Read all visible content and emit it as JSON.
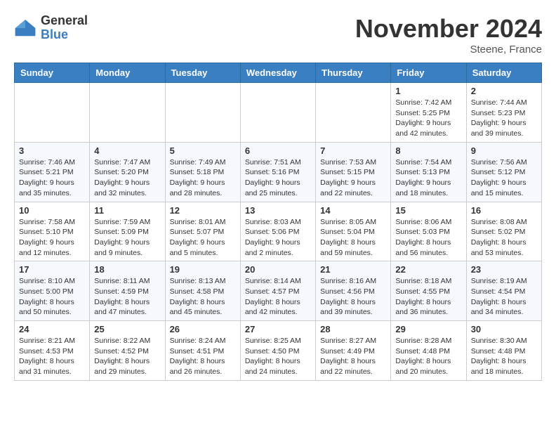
{
  "logo": {
    "general": "General",
    "blue": "Blue"
  },
  "title": "November 2024",
  "location": "Steene, France",
  "days_header": [
    "Sunday",
    "Monday",
    "Tuesday",
    "Wednesday",
    "Thursday",
    "Friday",
    "Saturday"
  ],
  "weeks": [
    [
      {
        "day": "",
        "info": ""
      },
      {
        "day": "",
        "info": ""
      },
      {
        "day": "",
        "info": ""
      },
      {
        "day": "",
        "info": ""
      },
      {
        "day": "",
        "info": ""
      },
      {
        "day": "1",
        "info": "Sunrise: 7:42 AM\nSunset: 5:25 PM\nDaylight: 9 hours and 42 minutes."
      },
      {
        "day": "2",
        "info": "Sunrise: 7:44 AM\nSunset: 5:23 PM\nDaylight: 9 hours and 39 minutes."
      }
    ],
    [
      {
        "day": "3",
        "info": "Sunrise: 7:46 AM\nSunset: 5:21 PM\nDaylight: 9 hours and 35 minutes."
      },
      {
        "day": "4",
        "info": "Sunrise: 7:47 AM\nSunset: 5:20 PM\nDaylight: 9 hours and 32 minutes."
      },
      {
        "day": "5",
        "info": "Sunrise: 7:49 AM\nSunset: 5:18 PM\nDaylight: 9 hours and 28 minutes."
      },
      {
        "day": "6",
        "info": "Sunrise: 7:51 AM\nSunset: 5:16 PM\nDaylight: 9 hours and 25 minutes."
      },
      {
        "day": "7",
        "info": "Sunrise: 7:53 AM\nSunset: 5:15 PM\nDaylight: 9 hours and 22 minutes."
      },
      {
        "day": "8",
        "info": "Sunrise: 7:54 AM\nSunset: 5:13 PM\nDaylight: 9 hours and 18 minutes."
      },
      {
        "day": "9",
        "info": "Sunrise: 7:56 AM\nSunset: 5:12 PM\nDaylight: 9 hours and 15 minutes."
      }
    ],
    [
      {
        "day": "10",
        "info": "Sunrise: 7:58 AM\nSunset: 5:10 PM\nDaylight: 9 hours and 12 minutes."
      },
      {
        "day": "11",
        "info": "Sunrise: 7:59 AM\nSunset: 5:09 PM\nDaylight: 9 hours and 9 minutes."
      },
      {
        "day": "12",
        "info": "Sunrise: 8:01 AM\nSunset: 5:07 PM\nDaylight: 9 hours and 5 minutes."
      },
      {
        "day": "13",
        "info": "Sunrise: 8:03 AM\nSunset: 5:06 PM\nDaylight: 9 hours and 2 minutes."
      },
      {
        "day": "14",
        "info": "Sunrise: 8:05 AM\nSunset: 5:04 PM\nDaylight: 8 hours and 59 minutes."
      },
      {
        "day": "15",
        "info": "Sunrise: 8:06 AM\nSunset: 5:03 PM\nDaylight: 8 hours and 56 minutes."
      },
      {
        "day": "16",
        "info": "Sunrise: 8:08 AM\nSunset: 5:02 PM\nDaylight: 8 hours and 53 minutes."
      }
    ],
    [
      {
        "day": "17",
        "info": "Sunrise: 8:10 AM\nSunset: 5:00 PM\nDaylight: 8 hours and 50 minutes."
      },
      {
        "day": "18",
        "info": "Sunrise: 8:11 AM\nSunset: 4:59 PM\nDaylight: 8 hours and 47 minutes."
      },
      {
        "day": "19",
        "info": "Sunrise: 8:13 AM\nSunset: 4:58 PM\nDaylight: 8 hours and 45 minutes."
      },
      {
        "day": "20",
        "info": "Sunrise: 8:14 AM\nSunset: 4:57 PM\nDaylight: 8 hours and 42 minutes."
      },
      {
        "day": "21",
        "info": "Sunrise: 8:16 AM\nSunset: 4:56 PM\nDaylight: 8 hours and 39 minutes."
      },
      {
        "day": "22",
        "info": "Sunrise: 8:18 AM\nSunset: 4:55 PM\nDaylight: 8 hours and 36 minutes."
      },
      {
        "day": "23",
        "info": "Sunrise: 8:19 AM\nSunset: 4:54 PM\nDaylight: 8 hours and 34 minutes."
      }
    ],
    [
      {
        "day": "24",
        "info": "Sunrise: 8:21 AM\nSunset: 4:53 PM\nDaylight: 8 hours and 31 minutes."
      },
      {
        "day": "25",
        "info": "Sunrise: 8:22 AM\nSunset: 4:52 PM\nDaylight: 8 hours and 29 minutes."
      },
      {
        "day": "26",
        "info": "Sunrise: 8:24 AM\nSunset: 4:51 PM\nDaylight: 8 hours and 26 minutes."
      },
      {
        "day": "27",
        "info": "Sunrise: 8:25 AM\nSunset: 4:50 PM\nDaylight: 8 hours and 24 minutes."
      },
      {
        "day": "28",
        "info": "Sunrise: 8:27 AM\nSunset: 4:49 PM\nDaylight: 8 hours and 22 minutes."
      },
      {
        "day": "29",
        "info": "Sunrise: 8:28 AM\nSunset: 4:48 PM\nDaylight: 8 hours and 20 minutes."
      },
      {
        "day": "30",
        "info": "Sunrise: 8:30 AM\nSunset: 4:48 PM\nDaylight: 8 hours and 18 minutes."
      }
    ]
  ]
}
